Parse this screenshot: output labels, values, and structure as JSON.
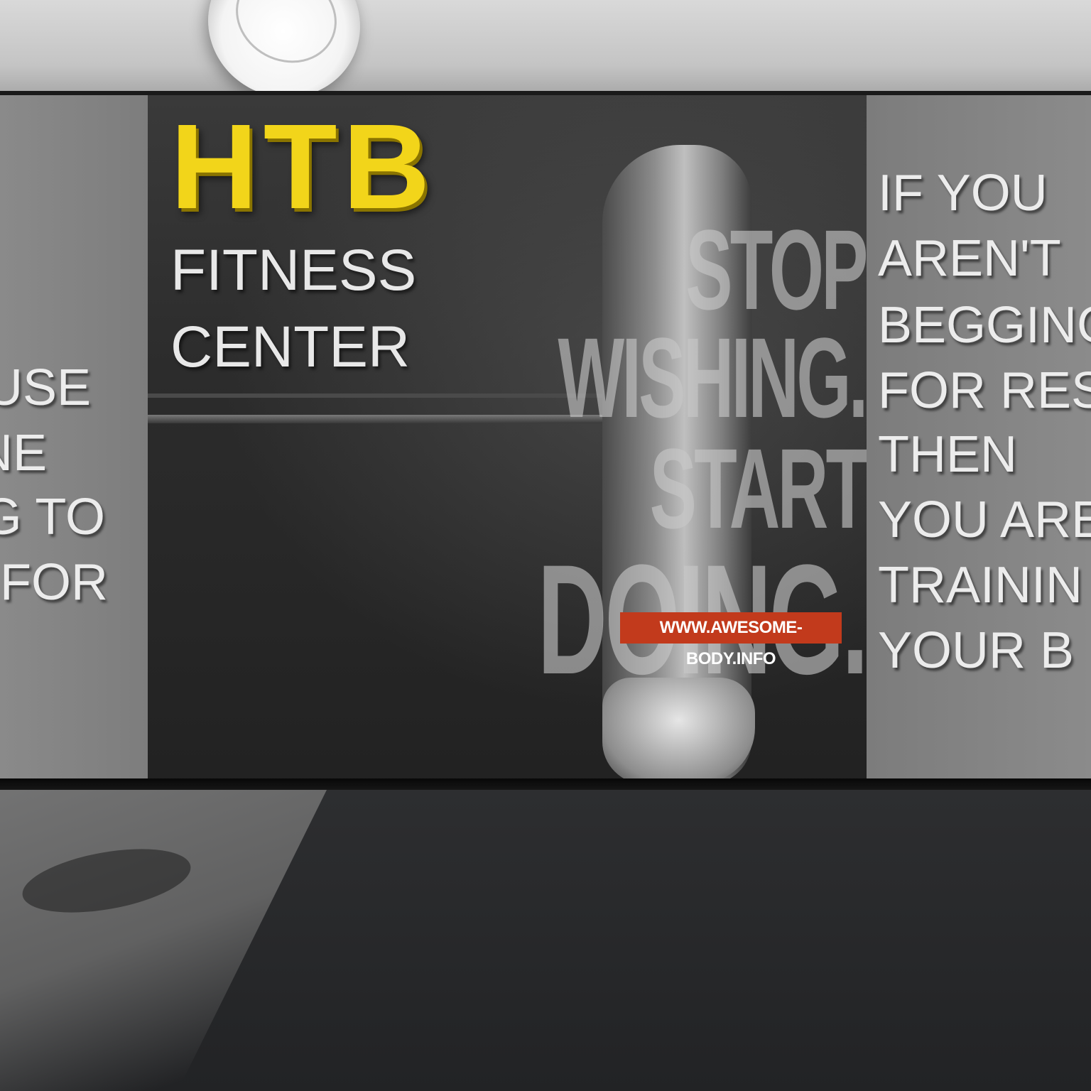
{
  "scene": {
    "gym_name": "HTB",
    "gym_subtitle_line1": "FITNESS",
    "gym_subtitle_line2": "CENTER",
    "poster_motto": [
      "STOP",
      "WISHING.",
      "START",
      "DOING."
    ],
    "poster_url": "WWW.AWESOME-BODY.INFO",
    "left_quote_fragments": [
      "USE",
      "NE",
      "G TO",
      "FOR"
    ],
    "right_quote_fragments": [
      "IF YOU",
      "AREN'T",
      "BEGGING",
      "FOR RES",
      "THEN",
      "YOU ARE",
      "TRAININ",
      "YOUR B"
    ]
  },
  "colors": {
    "brand_yellow": "#f2d51a",
    "url_badge_red": "#c23a1c",
    "wall_grey": "#858585",
    "poster_dark": "#2c2c2c"
  }
}
